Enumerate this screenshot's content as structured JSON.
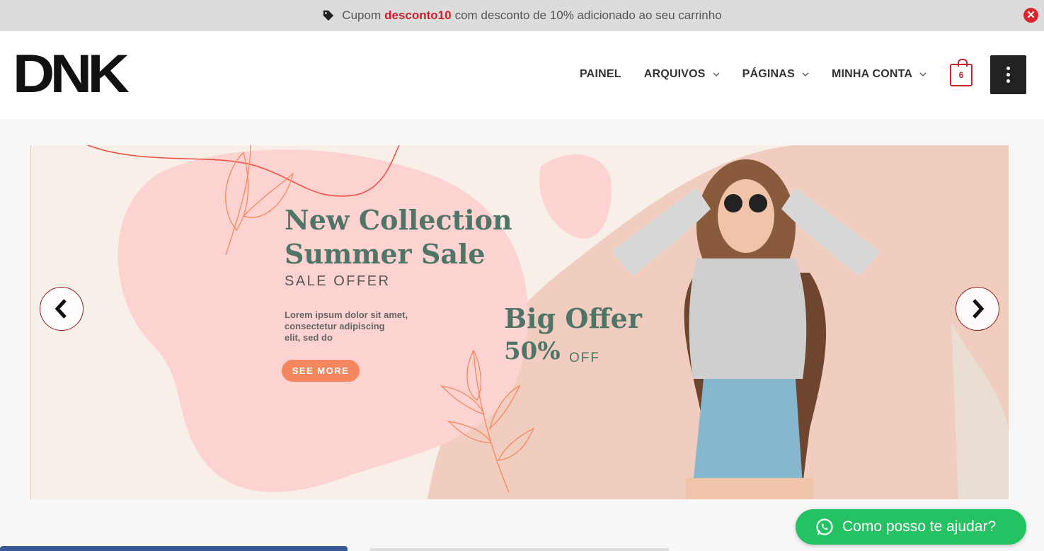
{
  "notice": {
    "prefix": "Cupom",
    "code": "desconto10",
    "suffix": "com desconto de 10% adicionado ao seu carrinho",
    "close_label": "✕"
  },
  "header": {
    "logo_text": "DNK",
    "nav": [
      {
        "label": "PAINEL",
        "has_dropdown": false
      },
      {
        "label": "ARQUIVOS",
        "has_dropdown": true
      },
      {
        "label": "PÁGINAS",
        "has_dropdown": true
      },
      {
        "label": "MINHA CONTA",
        "has_dropdown": true
      }
    ],
    "cart_count": "6"
  },
  "banner": {
    "headline_line1": "New Collection",
    "headline_line2": "Summer Sale",
    "sale_offer": "SALE OFFER",
    "lorem_line1": "Lorem ipsum dolor sit amet,",
    "lorem_line2": "consectetur adipiscing",
    "lorem_line3": "elit, sed do",
    "cta": "SEE MORE",
    "big_offer": "Big Offer",
    "percent": "50%",
    "off": "OFF"
  },
  "whatsapp": {
    "label": "Como posso te ajudar?"
  },
  "colors": {
    "accent": "#c8202f",
    "whatsapp": "#25c264",
    "headline": "#4f7468",
    "cta": "#f5875e"
  }
}
